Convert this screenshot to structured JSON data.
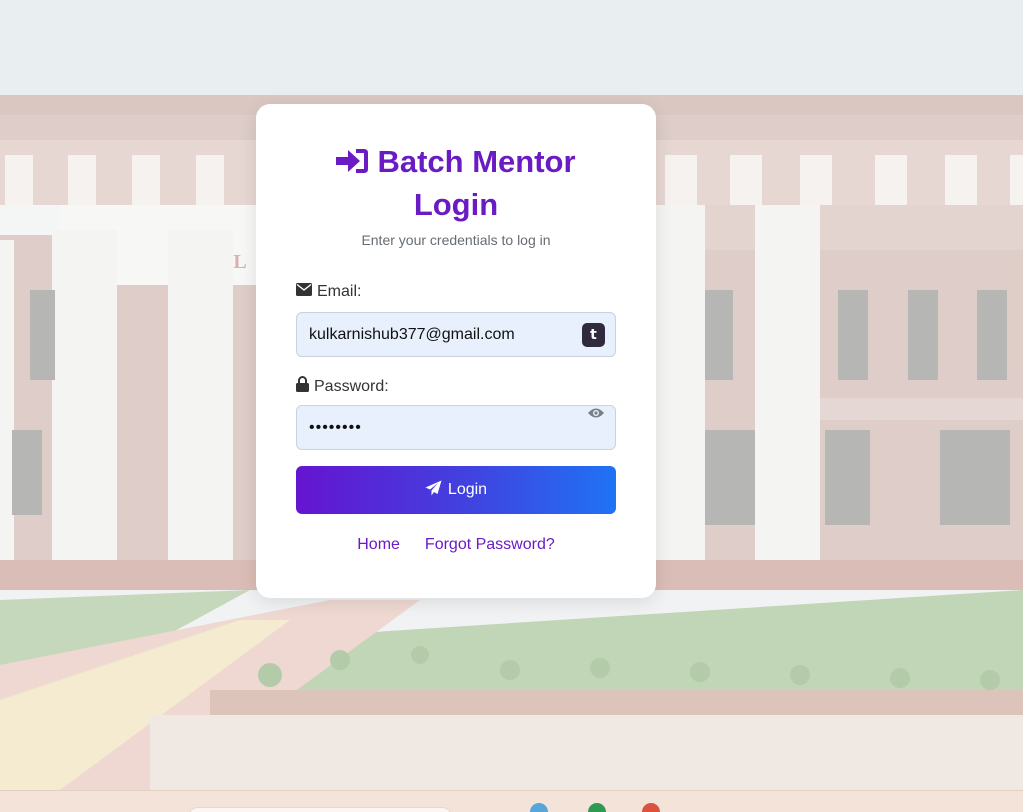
{
  "login": {
    "title": "Batch Mentor Login",
    "subtitle": "Enter your credentials to log in",
    "email_label": "Email:",
    "email_value": "kulkarnishub377@gmail.com",
    "password_label": "Password:",
    "password_value": "••••••••",
    "login_button": "Login",
    "links": {
      "home": "Home",
      "forgot_password": "Forgot Password?"
    },
    "extension_badge": "t"
  },
  "colors": {
    "accent": "#6a1bc4",
    "button_gradient_start": "#6514d0",
    "button_gradient_end": "#1f73f5",
    "input_bg": "#e8f0fe"
  },
  "icons": {
    "title": "sign-in-icon",
    "email": "envelope-icon",
    "password": "lock-icon",
    "password_toggle": "eye-icon",
    "login_button": "paper-plane-icon"
  }
}
